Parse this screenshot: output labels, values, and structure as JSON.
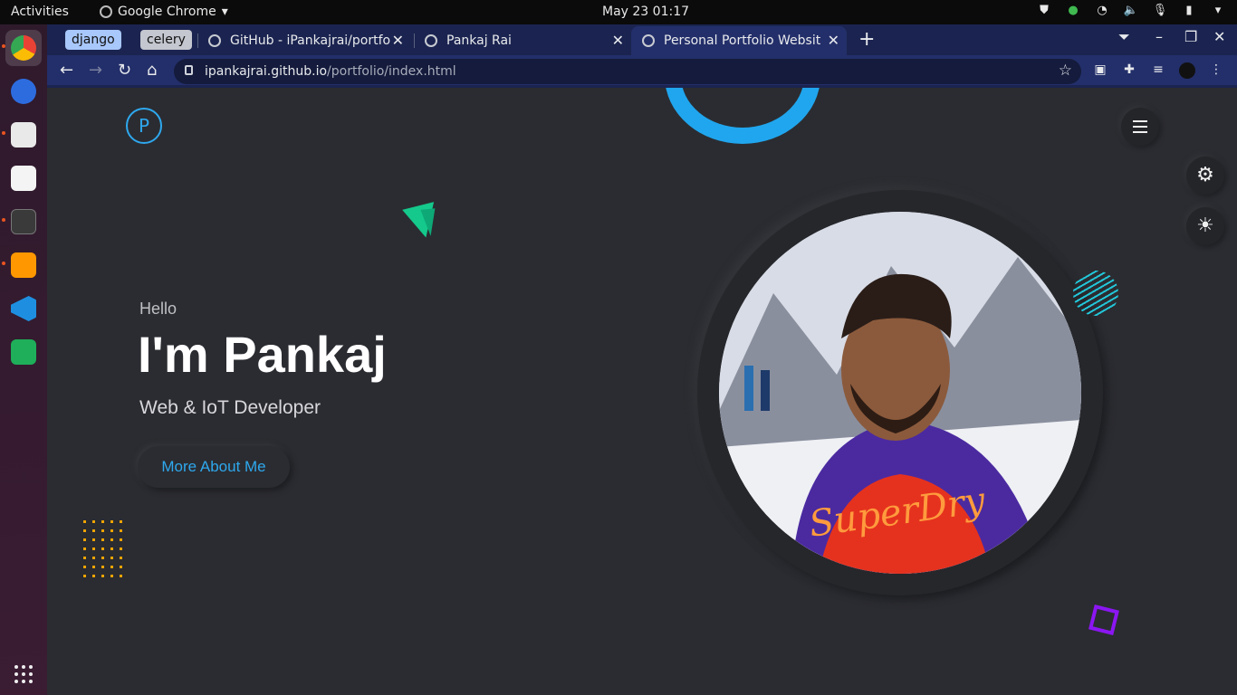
{
  "system_bar": {
    "activities": "Activities",
    "app_name": "Google Chrome",
    "clock": "May 23  01:17"
  },
  "browser": {
    "tab_groups": [
      {
        "label": "django",
        "color": "#a8c7fa"
      },
      {
        "label": "celery",
        "color": "#c4c7cf"
      }
    ],
    "tabs": [
      {
        "title": "GitHub - iPankajrai/portfo"
      },
      {
        "title": "Pankaj Rai"
      },
      {
        "title": "Personal Portfolio Websit",
        "active": true
      }
    ],
    "url_host": "ipankajrai.github.io",
    "url_path": "/portfolio/index.html"
  },
  "page": {
    "logo_letter": "P",
    "greeting": "Hello",
    "headline": "I'm Pankaj",
    "subtitle": "Web & IoT Developer",
    "cta_label": "More About Me",
    "accent_color": "#20a6ee",
    "icons": [
      "menu-icon",
      "gear-icon",
      "sun-icon"
    ]
  }
}
